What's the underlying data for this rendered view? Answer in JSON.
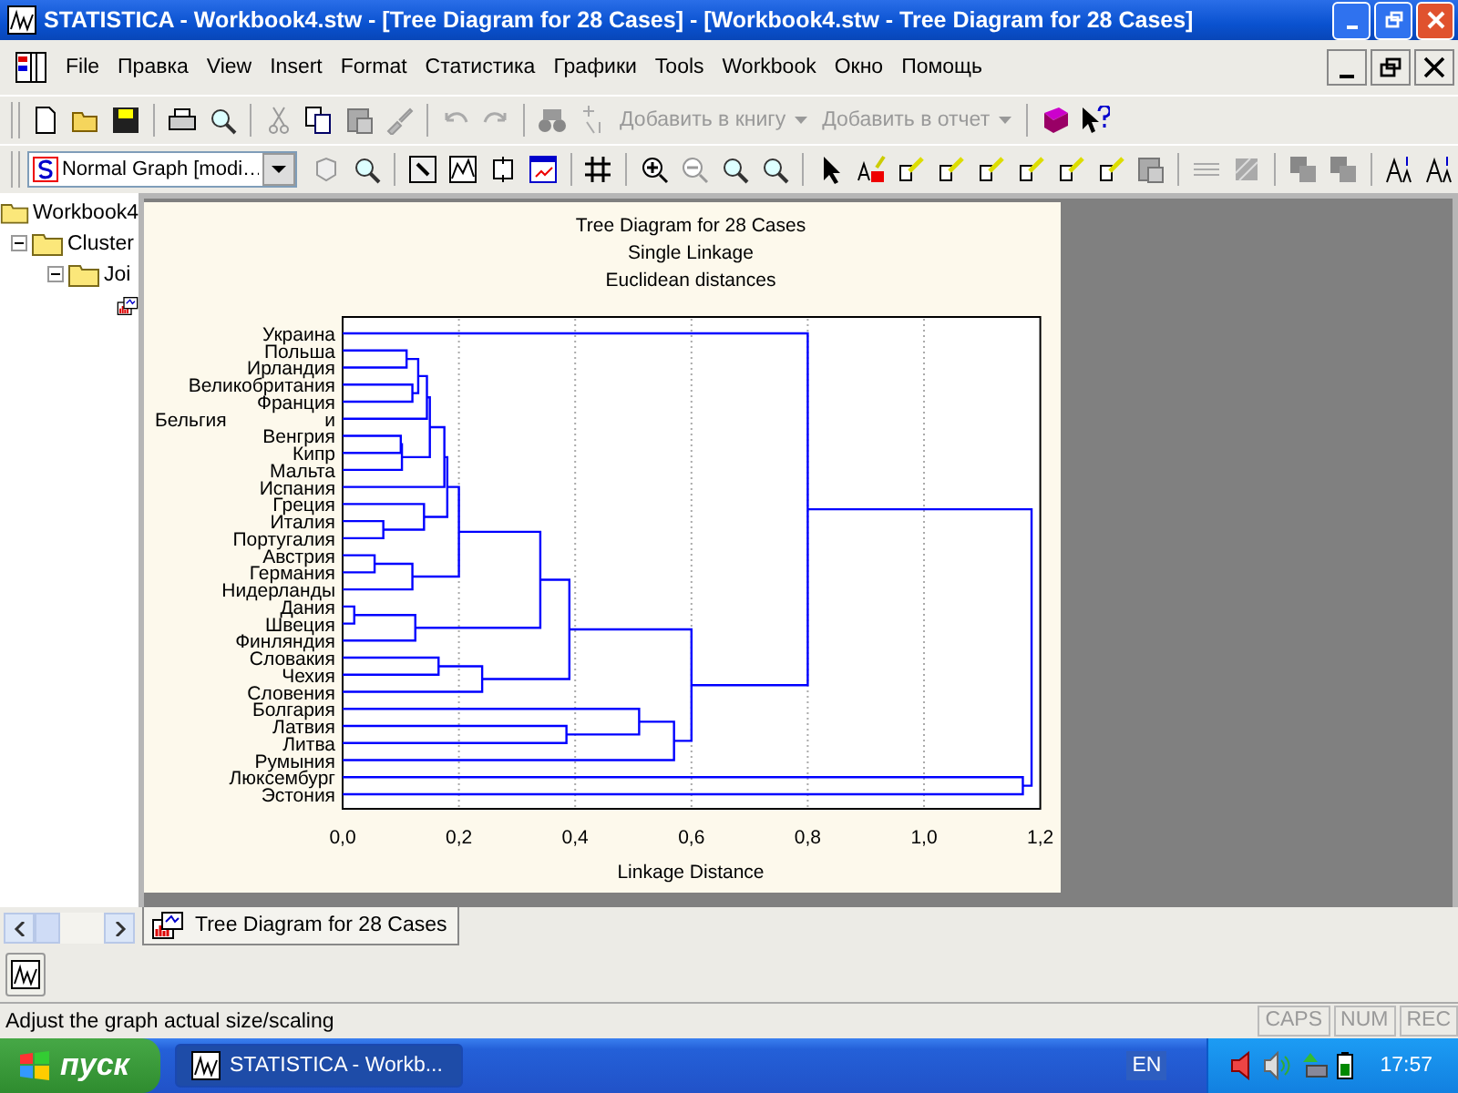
{
  "window": {
    "title": "STATISTICA - Workbook4.stw - [Tree Diagram for 28 Cases] - [Workbook4.stw - Tree Diagram for 28 Cases]"
  },
  "menu": [
    "File",
    "Правка",
    "View",
    "Insert",
    "Format",
    "Статистика",
    "Графики",
    "Tools",
    "Workbook",
    "Окно",
    "Помощь"
  ],
  "toolbar": {
    "buttons": [
      {
        "label": "Добавить в книгу",
        "disabled": true
      },
      {
        "label": "Добавить в отчет",
        "disabled": true
      }
    ],
    "graph_style": "Normal Graph [modi…"
  },
  "tree": [
    {
      "label": "Workbook4",
      "children": [
        {
          "label": "Cluster",
          "expanded": true,
          "children": [
            {
              "label": "Joi",
              "expanded": true,
              "children": [
                {
                  "kind": "graph"
                }
              ]
            }
          ]
        }
      ]
    }
  ],
  "graph": {
    "title_lines": [
      "Tree Diagram for 28 Cases",
      "Single Linkage",
      "Euclidean distances"
    ],
    "leaves": [
      "Украина",
      "Польша",
      "Ирландия",
      "Великобритания",
      "Франция",
      "и",
      "Венгрия",
      "Кипр",
      "Мальта",
      "Испания",
      "Греция",
      "Италия",
      "Португалия",
      "Австрия",
      "Германия",
      "Нидерланды",
      "Дания",
      "Швеция",
      "Финляндия",
      "Словакия",
      "Чехия",
      "Словения",
      "Болгария",
      "Латвия",
      "Литва",
      "Румыния",
      "Люксембург",
      "Эстония"
    ],
    "stray_label": "Бельгия",
    "x_ticks": [
      "0,0",
      "0,2",
      "0,4",
      "0,6",
      "0,8",
      "1,0",
      "1,2"
    ],
    "x_label": "Linkage Distance"
  },
  "document_tabs": [
    {
      "label": "Tree Diagram for 28 Cases",
      "selected": true
    }
  ],
  "status_bar": {
    "message": "Adjust the graph actual size/scaling",
    "indicators": [
      "CAPS",
      "NUM",
      "REC"
    ]
  },
  "taskbar": {
    "start": "пуск",
    "tasks": [
      {
        "label": "STATISTICA - Workb...",
        "selected": true
      }
    ],
    "language": "EN",
    "time": "17:57"
  }
}
